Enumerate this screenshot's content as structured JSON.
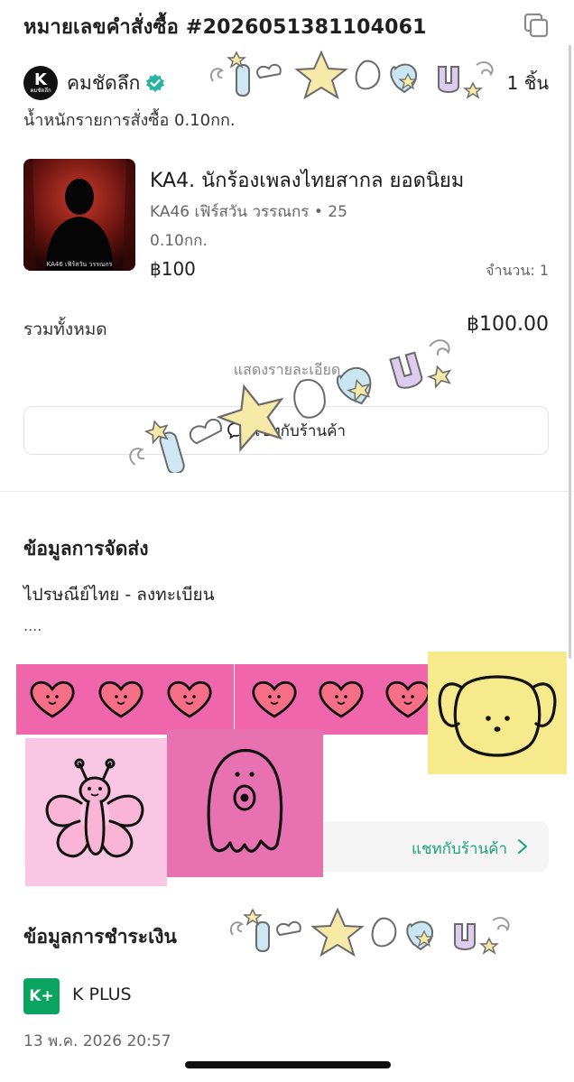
{
  "header": {
    "order_number_title": "หมายเลขคำสั่งซื้อ #2026051381104061"
  },
  "store": {
    "logo_letter": "K",
    "logo_sub": "คมชัดลึก",
    "name": "คมชัดลึก",
    "item_count": "1 ชิ้น"
  },
  "order": {
    "weight_text": "น้ำหนักรายการสั่งซื้อ 0.10กก."
  },
  "product": {
    "name": "KA4. นักร้องเพลงไทยสากล ยอดนิยม",
    "variant": "KA46 เฟิร์สวัน วรรณกร • 25 0.10กก.",
    "price": "฿100",
    "quantity": "จำนวน: 1",
    "thumb_caption": "KA46 เฟิร์สวัน วรรณกร"
  },
  "summary": {
    "total_label": "รวมทั้งหมด",
    "total_value": "฿100.00",
    "details_link": "แสดงรายละเอียด"
  },
  "chat": {
    "label": "แชทกับร้านค้า"
  },
  "shipping": {
    "heading": "ข้อมูลการจัดส่ง",
    "method": "ไปรษณีย์ไทย - ลงทะเบียน",
    "placeholder": "...."
  },
  "payment": {
    "heading": "ข้อมูลการชำระเงิน",
    "logo": "K+",
    "method": "K PLUS",
    "timestamp": "13 พ.ค. 2026 20:57"
  },
  "colors": {
    "accent": "#1aa37a",
    "verified": "#28b4a0",
    "kplus": "#0ba360",
    "sticker_pink": "#f066ad",
    "sticker_yellow": "#f6ea8c"
  }
}
